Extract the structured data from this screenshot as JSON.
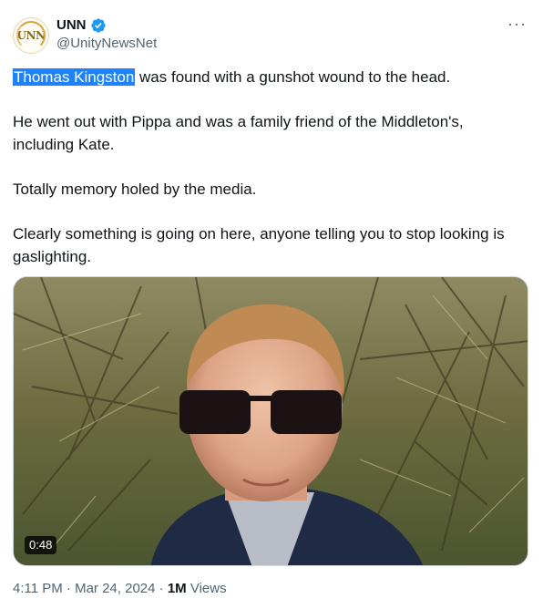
{
  "author": {
    "avatar_text": "UNN",
    "display_name": "UNN",
    "handle": "@UnityNewsNet",
    "verified_icon": "verified-badge-icon",
    "more_label": "···"
  },
  "tweet": {
    "highlighted": "Thomas Kingston",
    "line1_rest": " was found with a gunshot wound to the head.",
    "para2": "He went out with Pippa and was a family friend of the Middleton's, including Kate.",
    "para3": "Totally memory holed by the media.",
    "para4": "Clearly something is going on here, anyone telling you to stop looking is gaslighting."
  },
  "media": {
    "duration": "0:48"
  },
  "meta": {
    "time": "4:11 PM",
    "sep1": " · ",
    "date": "Mar 24, 2024",
    "sep2": " · ",
    "views_count": "1M",
    "views_label": " Views"
  },
  "colors": {
    "accent": "#1d9bf0",
    "highlight": "#1e82ff",
    "secondary_text": "#536471"
  }
}
